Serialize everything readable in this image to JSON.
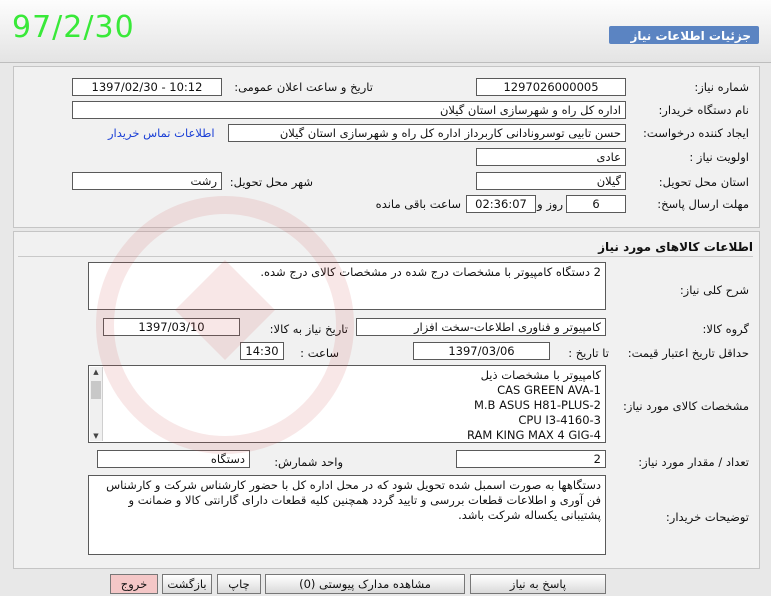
{
  "stamp_date": "97/2/30",
  "header_title": "جزئیات اطلاعات نیاز",
  "need": {
    "number_label": "شماره نیاز:",
    "number": "1297026000005",
    "announce_label": "تاریخ و ساعت اعلان عمومی:",
    "announce": "1397/02/30 - 10:12",
    "buyer_label": "نام دستگاه خریدار:",
    "buyer": "اداره کل راه و شهرسازی استان گیلان",
    "requester_label": "ایجاد کننده درخواست:",
    "requester": "حسن تابیی توسرونادانی کاربرداز اداره کل راه و شهرسازی استان گیلان",
    "contact_link": "اطلاعات تماس خریدار",
    "priority_label": "اولویت نیاز :",
    "priority": "عادی",
    "province_label": "استان محل تحویل:",
    "province": "گیلان",
    "city_label": "شهر محل تحویل:",
    "city": "رشت",
    "deadline_label": "مهلت ارسال پاسخ:",
    "days": "6",
    "days_suffix": "روز و",
    "time_left": "02:36:07",
    "time_suffix": "ساعت باقی مانده"
  },
  "goods": {
    "section_title": "اطلاعات کالاهای مورد نیاز",
    "summary_label": "شرح کلی نیاز:",
    "summary": "2 دستگاه کامپیوتر با مشخصات درج شده در مشخصات کالای درج شده.",
    "group_label": "گروه کالا:",
    "group": "کامپیوتر و فناوری اطلاعات-سخت افزار",
    "need_date_label": "تاریخ نیاز به کالا:",
    "need_date": "1397/03/10",
    "validity_label": "حداقل تاریخ اعتبار قیمت:",
    "until_label": "تا تاریخ :",
    "validity_date": "1397/03/06",
    "time_label": "ساعت :",
    "validity_time": "14:30",
    "specs_label": "مشخصات کالای مورد نیاز:",
    "specs": [
      "کامپیوتر با مشخصات ذیل",
      "CAS GREEN AVA-1",
      "M.B ASUS H81-PLUS-2",
      "CPU I3-4160-3",
      "RAM KING MAX 4 GIG-4"
    ],
    "qty_label": "تعداد / مقدار مورد نیاز:",
    "qty": "2",
    "unit_label": "واحد شمارش:",
    "unit": "دستگاه",
    "desc_label": "توضیحات خریدار:",
    "desc": "دستگاهها به صورت اسمبل شده تحویل شود که در محل اداره کل با حضور کارشناس شرکت و کارشناس فن آوری و اطلاعات قطعات بررسی و تایید گردد همچنین کلیه قطعات دارای گارانتی کالا و ضمانت و پشتیبانی یکساله شرکت باشد."
  },
  "buttons": {
    "respond": "پاسخ به نیاز",
    "attachments": "مشاهده مدارک پیوستی (0)",
    "print": "چاپ",
    "back": "بازگشت",
    "exit": "خروج"
  },
  "colors": {
    "header_bar": "#5b84c2",
    "stamp": "#39e939",
    "link": "#1a3fd6"
  }
}
